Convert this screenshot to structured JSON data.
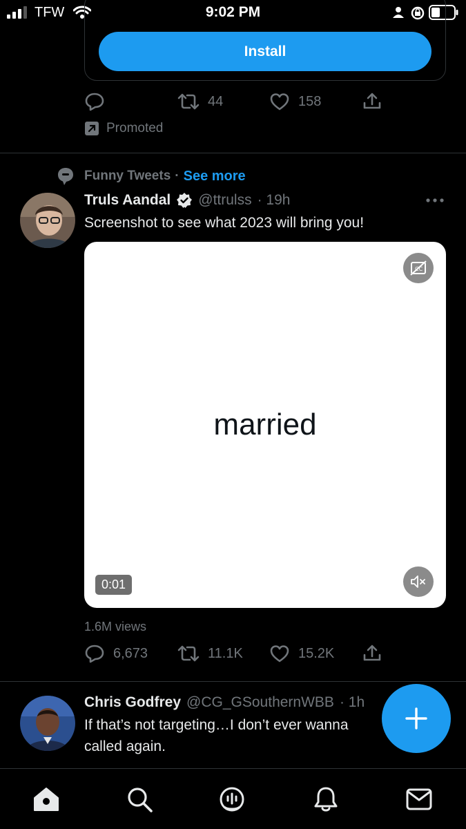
{
  "status_bar": {
    "carrier": "TFW",
    "time": "9:02 PM"
  },
  "promo_tweet": {
    "install_label": "Install",
    "retweets": "44",
    "likes": "158",
    "promoted_label": "Promoted"
  },
  "tweet1": {
    "social_context": "Funny Tweets",
    "separator": "·",
    "see_more": "See more",
    "author_name": "Truls Aandal",
    "handle": "@ttrulss",
    "time": "· 19h",
    "text": "Screenshot to see what 2023 will bring you!",
    "media_text": "married",
    "duration": "0:01",
    "views": "1.6M views",
    "replies": "6,673",
    "retweets": "11.1K",
    "likes": "15.2K"
  },
  "tweet2": {
    "author_name": "Chris Godfrey",
    "handle": "@CG_GSouthernWBB",
    "time": "· 1h",
    "text_line1": "If that’s not targeting…I don’t ever wanna",
    "text_line2": "called again."
  },
  "icons": [
    "signal-icon",
    "wifi-icon",
    "person-icon",
    "rotation-lock-icon",
    "battery-icon",
    "reply-icon",
    "retweet-icon",
    "like-icon",
    "share-icon",
    "promoted-icon",
    "topic-icon",
    "verified-icon",
    "more-icon",
    "captions-off-icon",
    "mute-icon",
    "compose-icon",
    "home-icon",
    "search-icon",
    "spaces-icon",
    "notifications-icon",
    "messages-icon"
  ],
  "colors": {
    "accent": "#1d9bf0",
    "background": "#000000",
    "secondary_text": "#71767b"
  }
}
